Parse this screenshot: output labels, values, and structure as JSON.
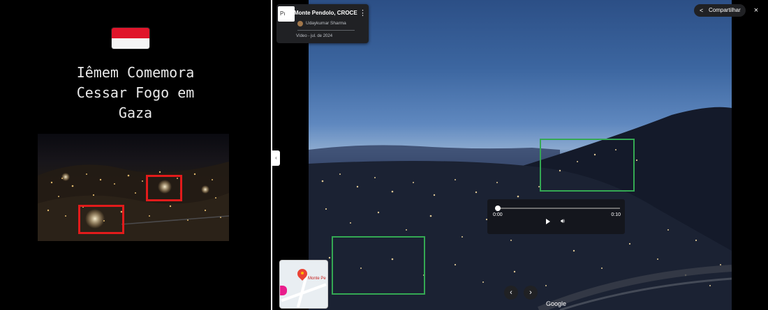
{
  "left_panel": {
    "headline_lines": [
      "Iêmem Comemora",
      "Cessar Fogo em",
      "Gaza"
    ],
    "flag": "yemen-flag",
    "highlight_color": "#e21b1b"
  },
  "street_view": {
    "photo_chip_label": "Pı",
    "place_title": "Monte Pendolo, CROCE",
    "author": "Udaykumar Sharma",
    "video_date": "Vídeo - jul. de 2024",
    "share_label": "Compartilhar",
    "close_label": "×",
    "collapse_label": "‹",
    "video": {
      "current_time": "0:00",
      "total_time": "0:10",
      "progress": 0.0
    },
    "minimap_label": "Monte Pe",
    "nav_prev": "‹",
    "nav_next": "›",
    "google_label": "Google",
    "highlight_color": "#34a853"
  }
}
